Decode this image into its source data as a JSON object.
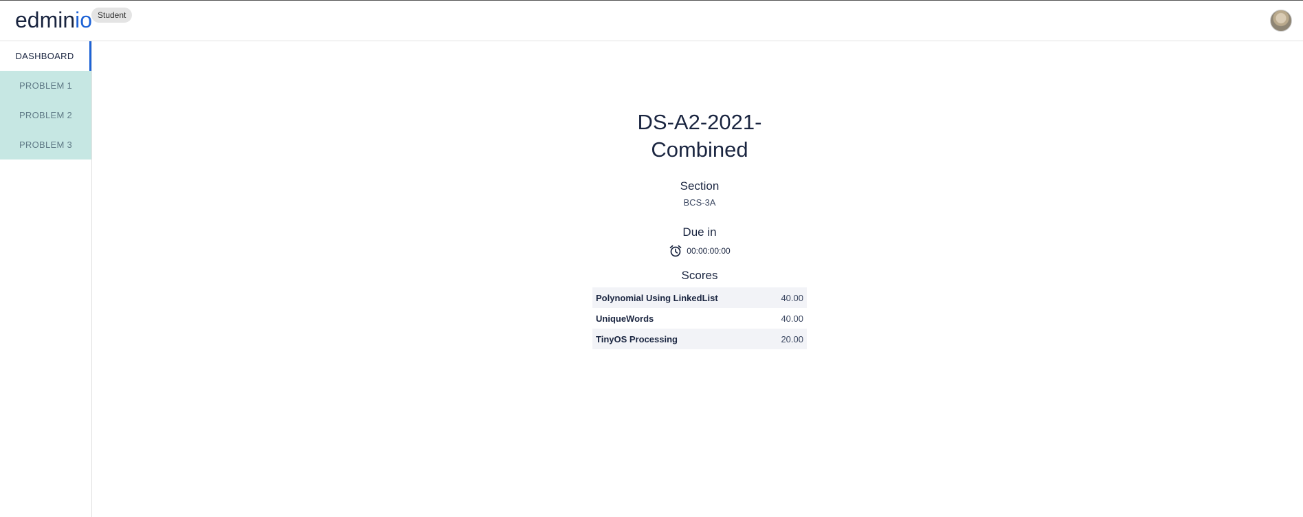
{
  "header": {
    "logo_main": "edmin",
    "logo_accent": "io",
    "role_badge": "Student"
  },
  "sidebar": {
    "items": [
      {
        "label": "DASHBOARD"
      },
      {
        "label": "PROBLEM 1"
      },
      {
        "label": "PROBLEM 2"
      },
      {
        "label": "PROBLEM 3"
      }
    ]
  },
  "assignment": {
    "title": "DS-A2-2021-Combined",
    "section_heading": "Section",
    "section_value": "BCS-3A",
    "due_heading": "Due in",
    "due_value": "00:00:00:00",
    "scores_heading": "Scores",
    "scores": [
      {
        "name": "Polynomial Using LinkedList",
        "score": "40.00"
      },
      {
        "name": "UniqueWords",
        "score": "40.00"
      },
      {
        "name": "TinyOS Processing",
        "score": "20.00"
      }
    ]
  },
  "colors": {
    "accent": "#1e63d6",
    "problem_tab_bg": "#c6e7e3",
    "text_dark": "#1a2540"
  },
  "icons": {
    "due": "alarm-clock-icon",
    "user": "avatar"
  }
}
